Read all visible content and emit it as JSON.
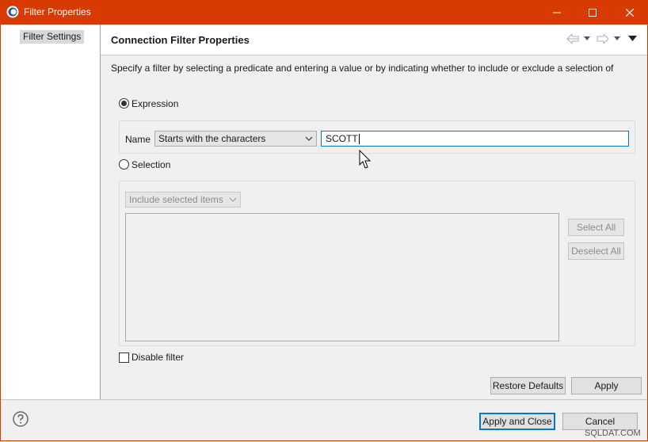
{
  "window": {
    "title": "Filter Properties",
    "accent_color": "#d83b01",
    "controls": [
      "minimize-icon",
      "maximize-icon",
      "close-icon"
    ]
  },
  "sidebar": {
    "items": [
      {
        "label": "Filter Settings",
        "selected": true
      }
    ]
  },
  "header": {
    "title": "Connection Filter Properties",
    "nav_icons": [
      "back-arrow-icon",
      "chevron-down-icon",
      "forward-arrow-icon",
      "chevron-down-icon",
      "menu-triangle-icon"
    ]
  },
  "description": "Specify a filter by selecting a predicate and entering a value or by indicating whether to include or exclude a selection of",
  "expression": {
    "radio_label": "Expression",
    "checked": true,
    "name_label": "Name",
    "predicate_selected": "Starts with the characters",
    "value": "SCOTT"
  },
  "selection": {
    "radio_label": "Selection",
    "checked": false,
    "mode_selected": "Include selected items",
    "select_all_label": "Select All",
    "deselect_all_label": "Deselect All"
  },
  "disable_filter": {
    "label": "Disable filter",
    "checked": false
  },
  "buttons": {
    "restore_defaults": "Restore Defaults",
    "apply": "Apply",
    "apply_and_close": "Apply and Close",
    "cancel": "Cancel"
  },
  "watermark": "SQLDAT.COM"
}
